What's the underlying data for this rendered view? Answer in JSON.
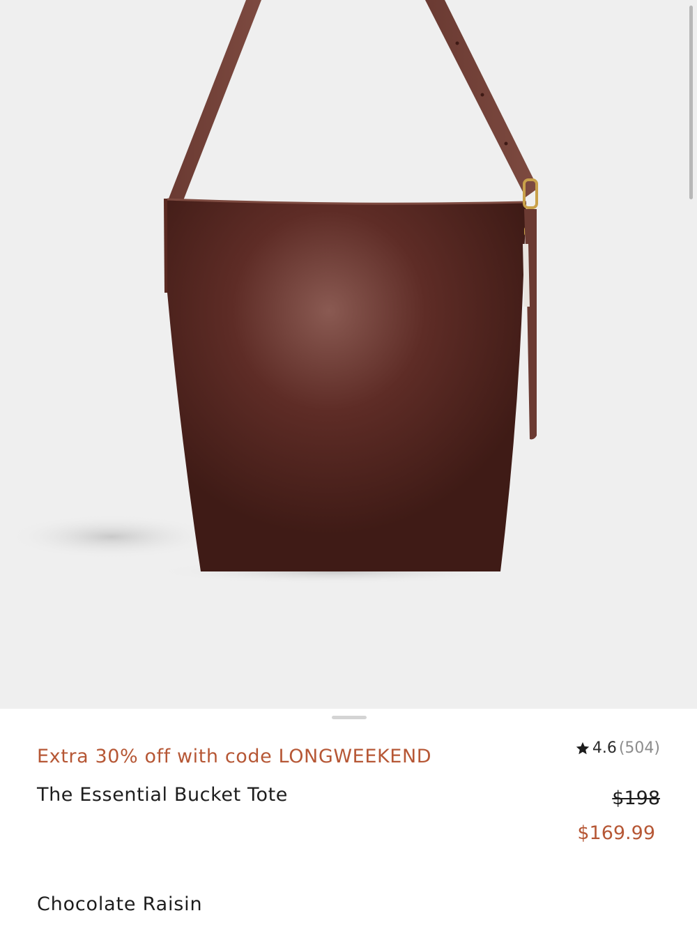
{
  "product": {
    "promo_text": "Extra 30% off with code LONGWEEKEND",
    "name": "The Essential Bucket Tote",
    "rating": "4.6",
    "review_count": "(504)",
    "price_original": "$198",
    "price_sale": "$169.99",
    "color_name": "Chocolate Raisin"
  },
  "icons": {
    "rating": "star-icon"
  },
  "colors": {
    "accent": "#b65735",
    "bag": "#5a2a22",
    "background": "#efefef"
  }
}
